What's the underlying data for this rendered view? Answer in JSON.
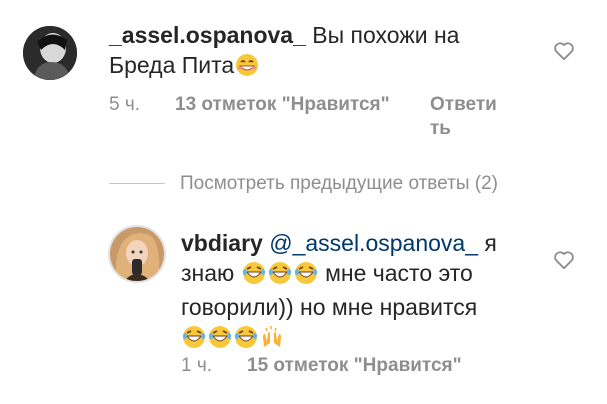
{
  "comment1": {
    "username": "_assel.ospanova_",
    "text_line1": "Вы похожи на",
    "text_line2": "Бреда Пита",
    "time": "5 ч.",
    "likes": "13 отметок \"Нравится\"",
    "reply_line1": "Ответи",
    "reply_line2": "ть"
  },
  "replies_toggle": {
    "label": "Посмотреть предыдущие ответы (2)"
  },
  "comment2": {
    "username": "vbdiary",
    "mention": "@_assel.ospanova_",
    "text_after_mention": "я",
    "text_line2_a": "знаю",
    "text_line2_b": "мне часто это",
    "text_line3": "говорили)) но мне нравится",
    "time": "1 ч.",
    "likes": "15 отметок \"Нравится\""
  },
  "icons": {
    "heart": "heart-outline-icon",
    "smile": "grinning-sweat-emoji",
    "laugh": "tears-of-joy-emoji",
    "hands": "raising-hands-emoji"
  }
}
